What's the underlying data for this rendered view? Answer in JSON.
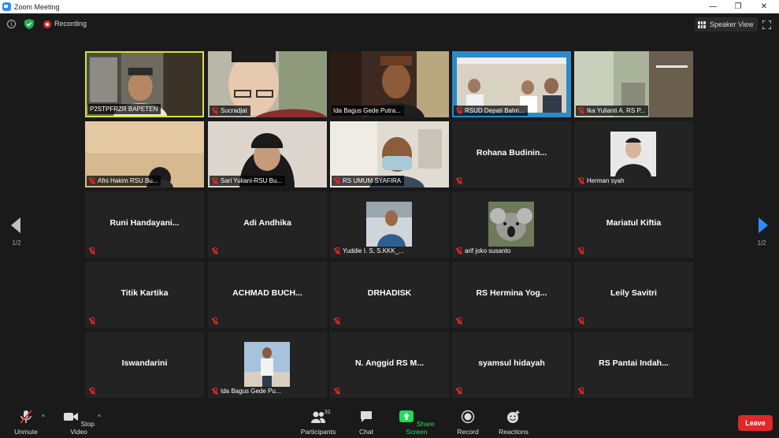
{
  "window": {
    "title": "Zoom Meeting",
    "minimize": "—",
    "restore": "❐",
    "close": "✕"
  },
  "topbar": {
    "info_glyph": "i",
    "recording_label": "Recording",
    "speaker_view_label": "Speaker View"
  },
  "pagination": {
    "left_page": "1/2",
    "right_page": "1/2"
  },
  "participants": [
    {
      "name": "P2STPFRZR BAPETEN",
      "kind": "video",
      "active": true
    },
    {
      "name": "Sucradjat",
      "kind": "video"
    },
    {
      "name": "Ida Bagus Gede Putra...",
      "kind": "video"
    },
    {
      "name": "RSUD Depati Bahri...",
      "kind": "video"
    },
    {
      "name": "Ika Yulianti A. RS P...",
      "kind": "video"
    },
    {
      "name": "Afni Hakim RSU Bu...",
      "kind": "video"
    },
    {
      "name": "Sari Yuliani-RSU Bu...",
      "kind": "video"
    },
    {
      "name": "RS UMUM SYAFIRA",
      "kind": "video"
    },
    {
      "name": "Rohana Budinin...",
      "kind": "name"
    },
    {
      "name": "Herman syah",
      "kind": "avatar"
    },
    {
      "name": "Runi Handayani...",
      "kind": "name"
    },
    {
      "name": "Adi Andhika",
      "kind": "name"
    },
    {
      "name": "Yuddie I. S, S.KKK_...",
      "kind": "avatar"
    },
    {
      "name": "arif joko susanto",
      "kind": "avatar"
    },
    {
      "name": "Mariatul Kiftia",
      "kind": "name"
    },
    {
      "name": "Titik Kartika",
      "kind": "name"
    },
    {
      "name": "ACHMAD BUCH...",
      "kind": "name"
    },
    {
      "name": "DRHADISK",
      "kind": "name"
    },
    {
      "name": "RS Hermina Yog...",
      "kind": "name"
    },
    {
      "name": "Leily Savitri",
      "kind": "name"
    },
    {
      "name": "Iswandarini",
      "kind": "name"
    },
    {
      "name": "Ida Bagus Gede Pu...",
      "kind": "avatar"
    },
    {
      "name": "N. Anggid RS M...",
      "kind": "name"
    },
    {
      "name": "syamsul hidayah",
      "kind": "name"
    },
    {
      "name": "RS Pantai Indah...",
      "kind": "name"
    }
  ],
  "toolbar": {
    "unmute": "Unmute",
    "stop_video": "Stop Video",
    "participants": "Participants",
    "participants_count": "31",
    "chat": "Chat",
    "share_screen": "Share Screen",
    "record": "Record",
    "reactions": "Reactions",
    "leave": "Leave",
    "caret": "^"
  },
  "colors": {
    "background": "#1a1a1a",
    "tile": "#232323",
    "active_speaker_border": "#d4e23a",
    "share_green": "#23d959",
    "leave_red": "#e02828",
    "accent_blue": "#2d8cff"
  }
}
